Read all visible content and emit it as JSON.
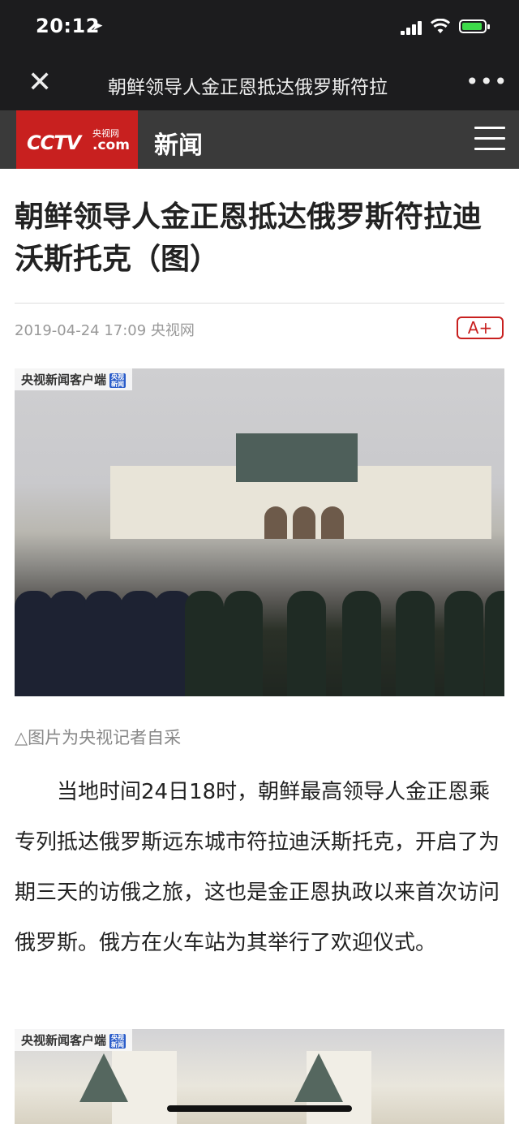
{
  "status_bar": {
    "time": "20:12"
  },
  "nav": {
    "close_label": "✕",
    "title": "朝鲜领导人金正恩抵达俄罗斯符拉",
    "more_label": "•••"
  },
  "header": {
    "logo_main": "CCTV",
    "logo_small": "央视网",
    "logo_com": ".com",
    "section": "新闻"
  },
  "article": {
    "title": "朝鲜领导人金正恩抵达俄罗斯符拉迪沃斯托克（图）",
    "meta": "2019-04-24 17:09 央视网",
    "font_size_button": "A+",
    "image1_watermark": "央视新闻客户端",
    "image1_caption": "△图片为央视记者自采",
    "paragraph": "　　当地时间24日18时，朝鲜最高领导人金正恩乘专列抵达俄罗斯远东城市符拉迪沃斯托克，开启了为期三天的访俄之旅，这也是金正恩执政以来首次访问俄罗斯。俄方在火车站为其举行了欢迎仪式。",
    "image2_watermark": "央视新闻客户端"
  },
  "colors": {
    "brand_red": "#c8201f",
    "dark_bar": "#1c1c1e",
    "header_gray": "#3a3a3a"
  }
}
